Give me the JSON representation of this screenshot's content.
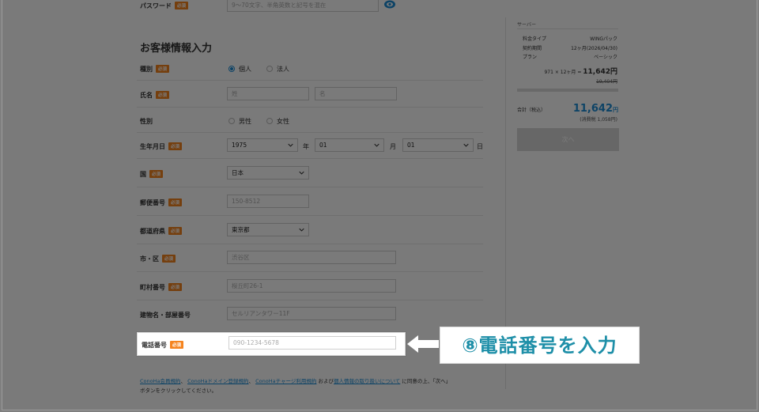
{
  "password": {
    "label": "パスワード",
    "required_badge": "必須",
    "placeholder": "9〜70文字、半角英数と記号を混在"
  },
  "section_title": "お客様情報入力",
  "fields": {
    "type": {
      "label": "種別",
      "badge": "必須",
      "options": [
        "個人",
        "法人"
      ],
      "selected": "個人"
    },
    "name": {
      "label": "氏名",
      "badge": "必須",
      "placeholder_last": "姓",
      "placeholder_first": "名"
    },
    "gender": {
      "label": "性別",
      "options": [
        "男性",
        "女性"
      ]
    },
    "birth": {
      "label": "生年月日",
      "badge": "必須",
      "year": "1975",
      "year_unit": "年",
      "month": "01",
      "month_unit": "月",
      "day": "01",
      "day_unit": "日"
    },
    "country": {
      "label": "国",
      "badge": "必須",
      "value": "日本"
    },
    "postal": {
      "label": "郵便番号",
      "badge": "必須",
      "placeholder": "150-8512"
    },
    "prefecture": {
      "label": "都道府県",
      "badge": "必須",
      "value": "東京都"
    },
    "city": {
      "label": "市・区",
      "badge": "必須",
      "placeholder": "渋谷区"
    },
    "town": {
      "label": "町村番号",
      "badge": "必須",
      "placeholder": "桜丘町26-1"
    },
    "building": {
      "label": "建物名・部屋番号",
      "placeholder": "セルリアンタワー11F"
    },
    "phone": {
      "label": "電話番号",
      "badge": "必須",
      "placeholder": "090-1234-5678"
    }
  },
  "agreement": {
    "link1": "ConoHa会員規約",
    "sep1": "、",
    "link2": "ConoHaドメイン登録規約",
    "sep2": "、",
    "link3": "ConoHaチャージ利用規約",
    "and": "および",
    "link4": "個人情報の取り扱いについて",
    "tail": "に同意の上、「次へ」",
    "line2": "ボタンをクリックしてください。"
  },
  "summary": {
    "header": "サーバー",
    "rows": [
      {
        "k": "料金タイプ",
        "v": "WINGパック"
      },
      {
        "k": "契約期間",
        "v": "12ヶ月(2026/04/30)"
      },
      {
        "k": "プラン",
        "v": "ベーシック"
      }
    ],
    "calc": "971 × 12ヶ月 = ",
    "calc_total": "11,642円",
    "strike": "19,404円",
    "total_label": "合計（税込）",
    "total_value": "11,642",
    "total_unit": "円",
    "tax_note": "(消費税 1,058円)",
    "next_button": "次へ"
  },
  "callout": "⑧電話番号を入力",
  "colors": {
    "accent": "#1d8dd6",
    "badge": "#f5841f",
    "callout_text": "#1e8fa8"
  }
}
